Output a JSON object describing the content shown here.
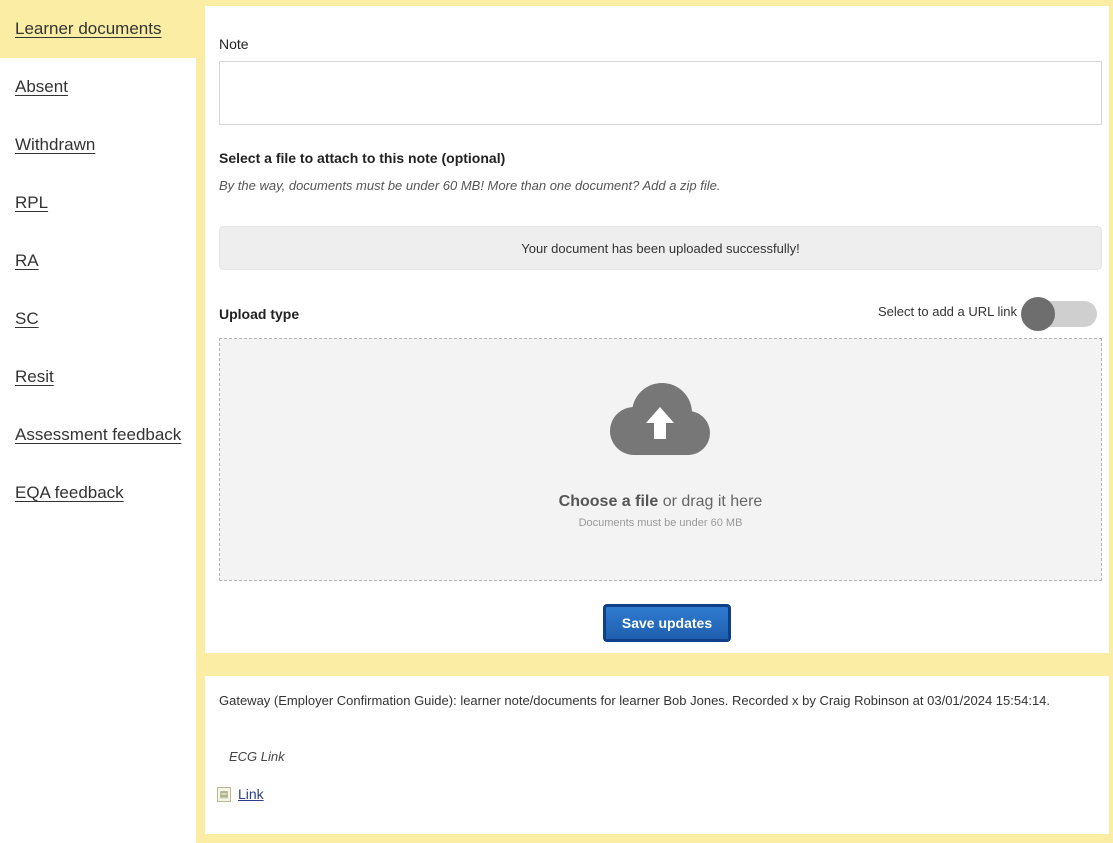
{
  "sidebar": {
    "items": [
      {
        "label": "Learner documents",
        "active": true
      },
      {
        "label": "Absent"
      },
      {
        "label": "Withdrawn"
      },
      {
        "label": "RPL"
      },
      {
        "label": "RA"
      },
      {
        "label": "SC"
      },
      {
        "label": "Resit"
      },
      {
        "label": "Assessment feedback"
      },
      {
        "label": "EQA feedback"
      }
    ]
  },
  "form": {
    "note_label": "Note",
    "note_value": "",
    "attach_label": "Select a file to attach to this note (optional)",
    "attach_hint": "By the way, documents must be under 60 MB! More than one document? Add a zip file.",
    "success_message": "Your document has been uploaded successfully!",
    "upload_type_label": "Upload type",
    "url_toggle_label": "Select to add a URL link",
    "url_toggle_on": false,
    "dropzone": {
      "choose": "Choose a file",
      "drag": " or drag it here",
      "sub": "Documents must be under 60 MB"
    },
    "save_label": "Save updates"
  },
  "record": {
    "text": "Gateway (Employer Confirmation Guide): learner note/documents for learner Bob Jones. Recorded x by Craig Robinson at 03/01/2024 15:54:14.",
    "link_title": "ECG Link",
    "link_text": "Link"
  },
  "colors": {
    "accent_yellow": "#fbeea4",
    "button_blue": "#1f5fae",
    "toggle_knob": "#6e6e6e"
  },
  "icons": {
    "dropzone": "cloud-upload-icon",
    "record_file": "file-icon",
    "note_resize": "resize-grip-icon"
  }
}
